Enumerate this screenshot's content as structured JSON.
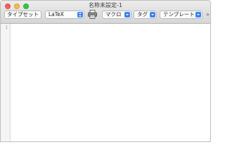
{
  "window": {
    "title": "名称未設定-1"
  },
  "toolbar": {
    "typeset_label": "タイプセット",
    "engine_select": {
      "value": "LaTeX"
    },
    "print_icon": "printer-icon",
    "macro_select": {
      "value": "マクロ"
    },
    "tag_select": {
      "value": "タグ"
    },
    "template_select": {
      "value": "テンプレート"
    },
    "overflow_label": "»"
  },
  "editor": {
    "line_numbers": [
      "1"
    ]
  },
  "colors": {
    "close": "#fc605c",
    "minimize": "#fdbc40",
    "zoom": "#34c84a",
    "accent": "#3b82f6"
  }
}
